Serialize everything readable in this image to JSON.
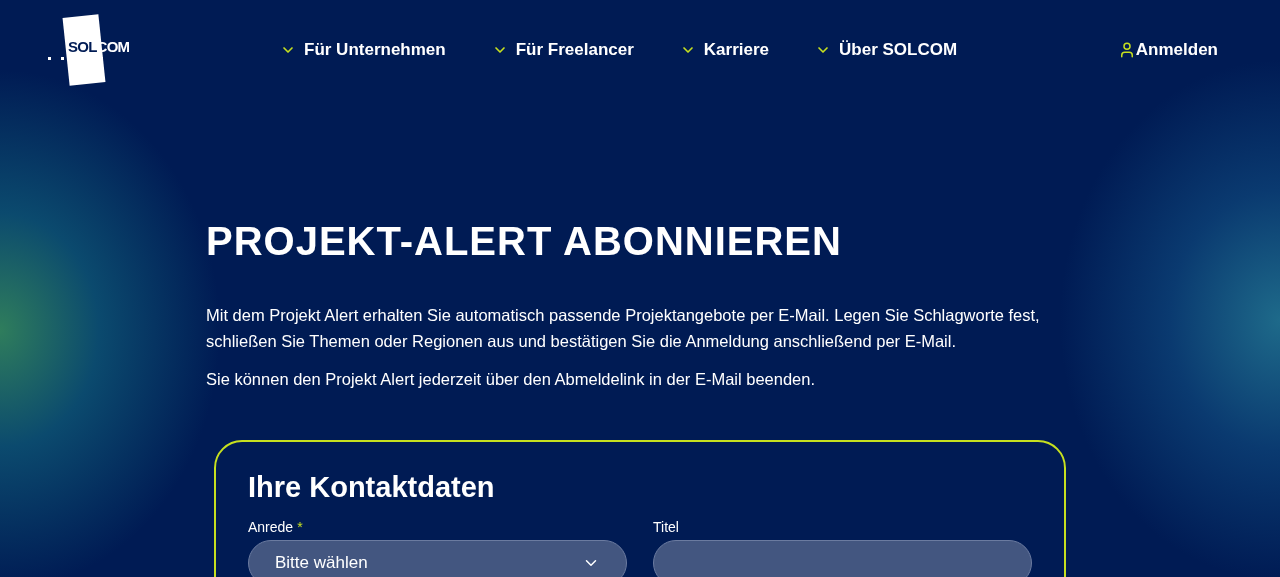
{
  "logo": {
    "part_1": "SOL",
    "part_2": "COM"
  },
  "nav": [
    {
      "label": "Für Unternehmen"
    },
    {
      "label": "Für Freelancer"
    },
    {
      "label": "Karriere"
    },
    {
      "label": "Über SOLCOM"
    }
  ],
  "login": {
    "label": "Anmelden"
  },
  "title": "PROJEKT-ALERT ABONNIEREN",
  "paragraphs": [
    "Mit dem Projekt Alert erhalten Sie automatisch passende Projektangebote per E-Mail. Legen Sie Schlagworte fest, schließen Sie Themen oder Regionen aus und bestätigen Sie die Anmeldung anschließend per E-Mail.",
    "Sie können den Projekt Alert jederzeit über den Abmeldelink in der E-Mail beenden."
  ],
  "form": {
    "title": "Ihre Kontaktdaten",
    "fields": [
      {
        "kind": "select",
        "label": "Anrede",
        "required": true,
        "required_mark": "*",
        "value": "Bitte wählen"
      },
      {
        "kind": "text",
        "label": "Titel",
        "required": false
      }
    ]
  }
}
